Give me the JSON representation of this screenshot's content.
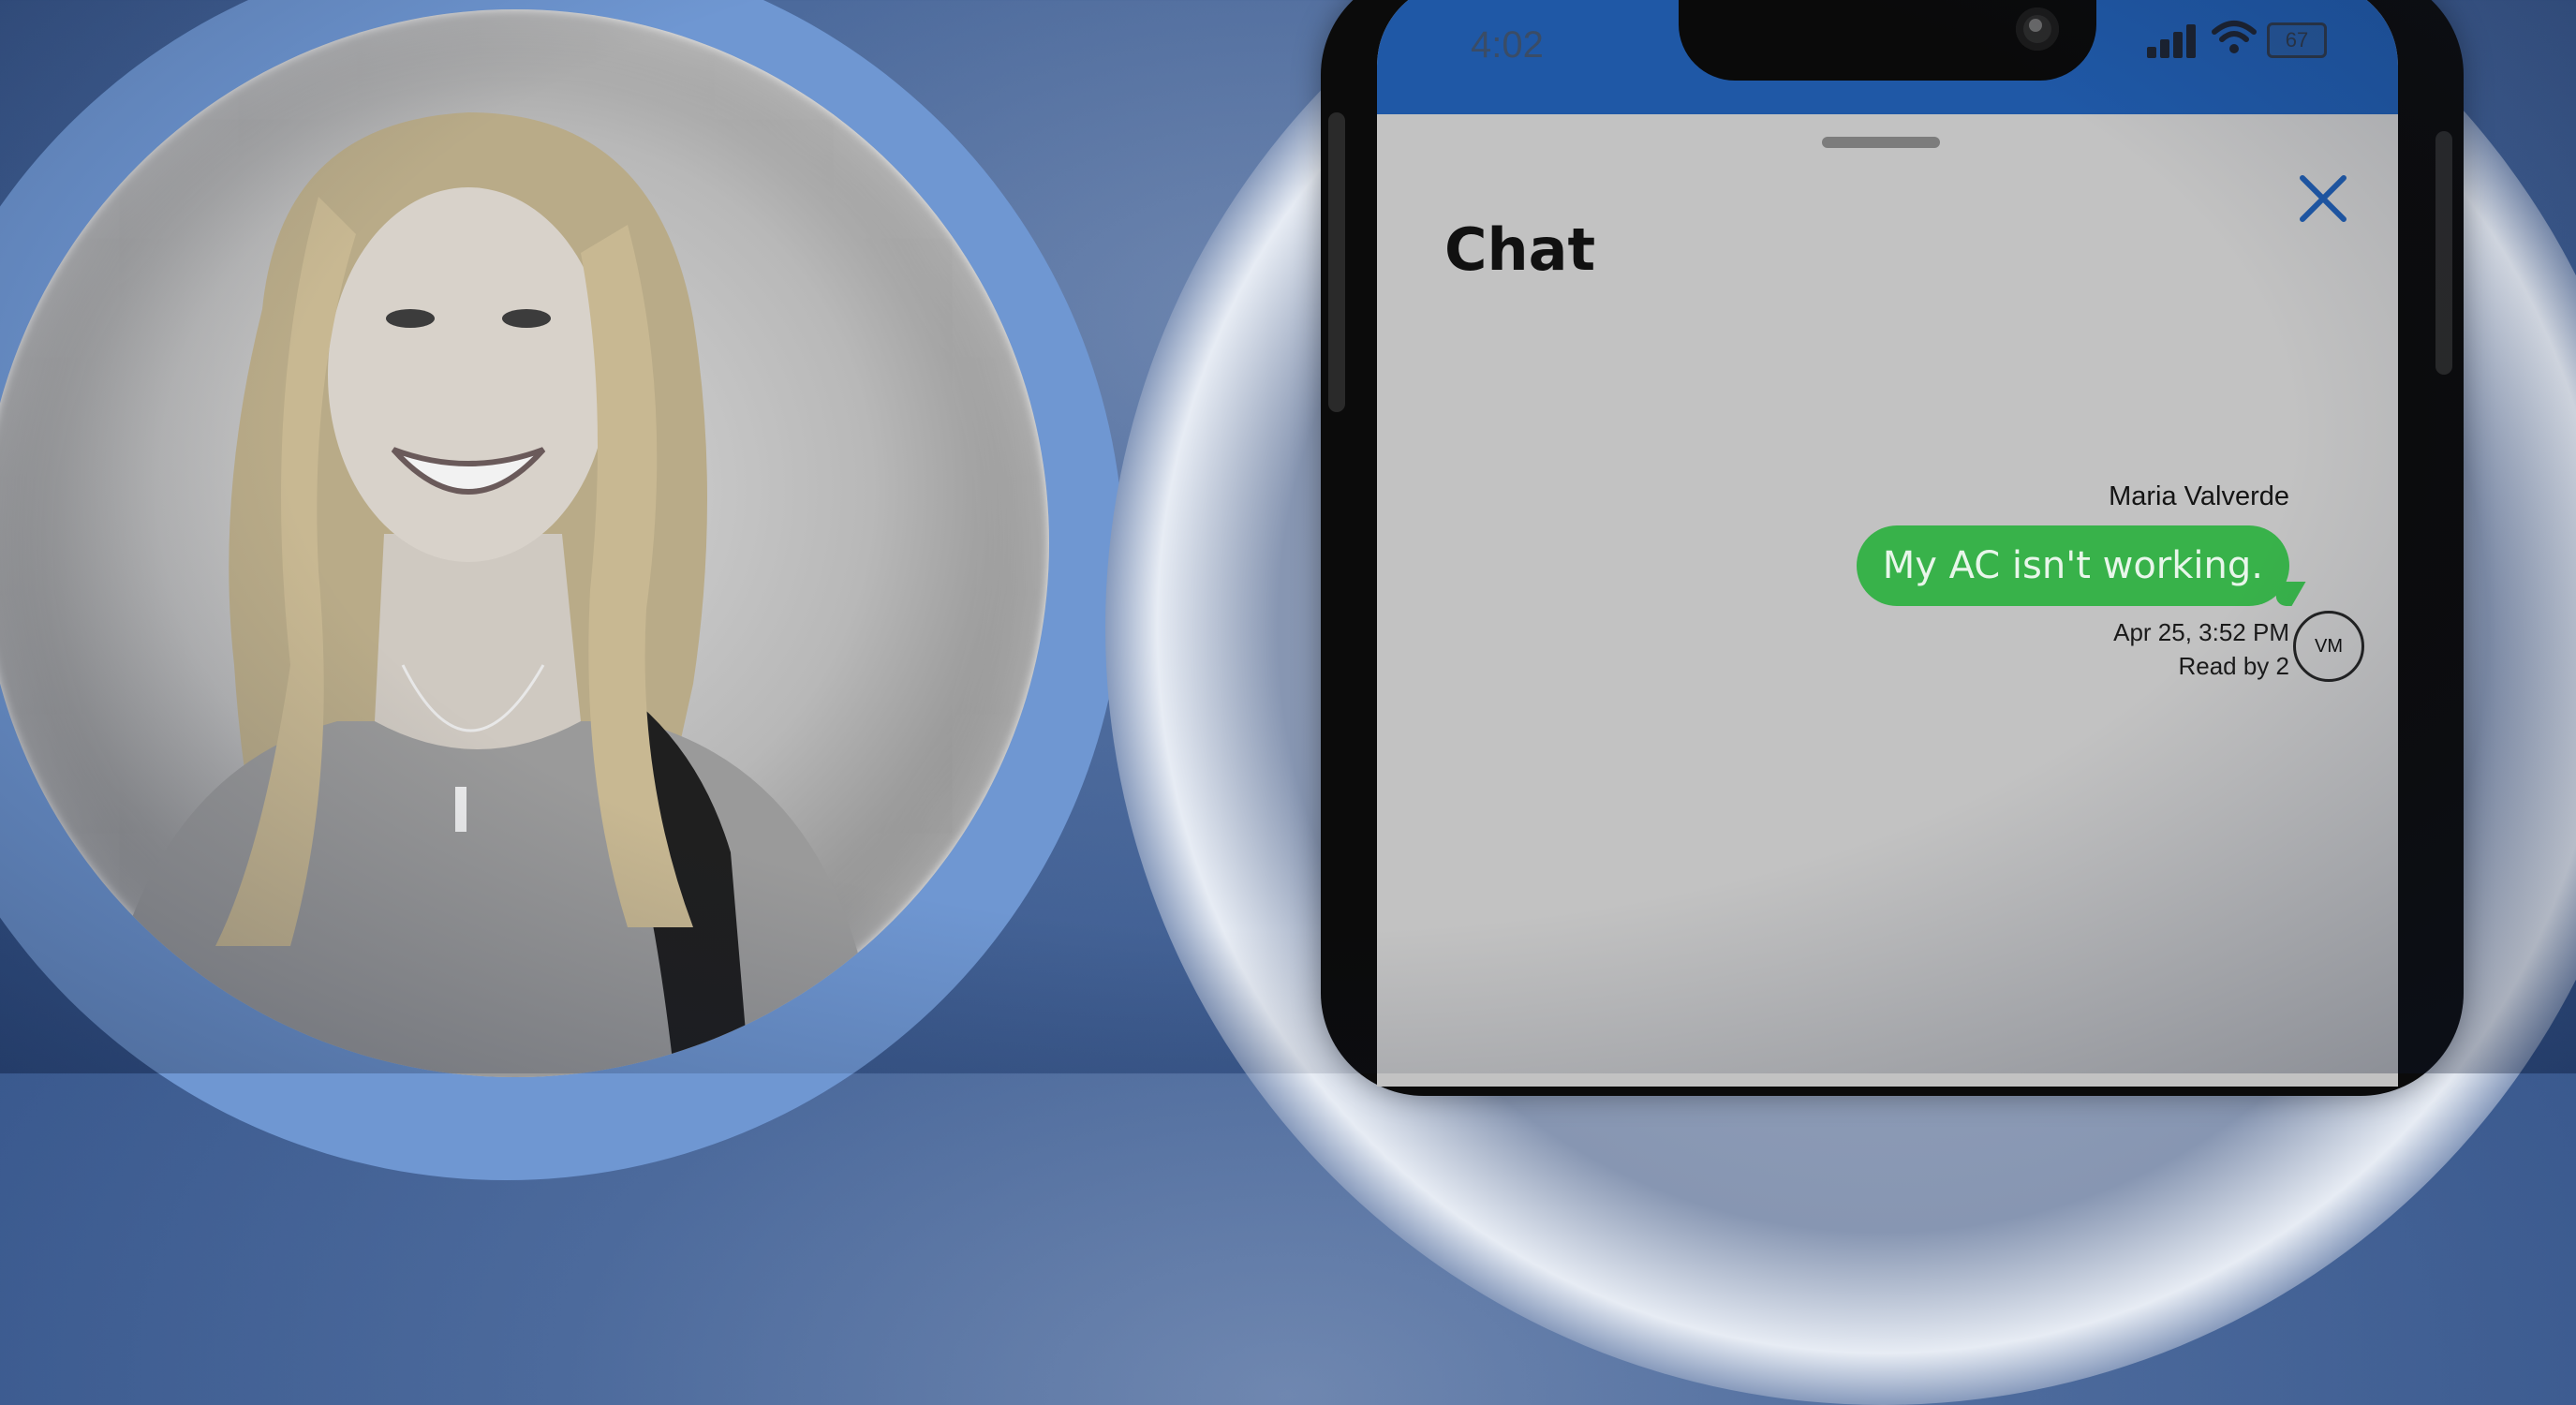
{
  "colors": {
    "accent_blue": "#1f58a6",
    "message_green": "#38b24a",
    "close_blue": "#1f58a6"
  },
  "status_bar": {
    "time": "4:02",
    "battery": "67",
    "icons": [
      "signal-icon",
      "wifi-icon",
      "battery-icon"
    ]
  },
  "chat": {
    "title": "Chat",
    "close_icon": "close-icon",
    "message": {
      "sender": "Maria Valverde",
      "text": "My AC isn't working.",
      "timestamp": "Apr 25, 3:52 PM",
      "read_receipt": "Read by 2",
      "avatar_initials": "VM"
    }
  }
}
